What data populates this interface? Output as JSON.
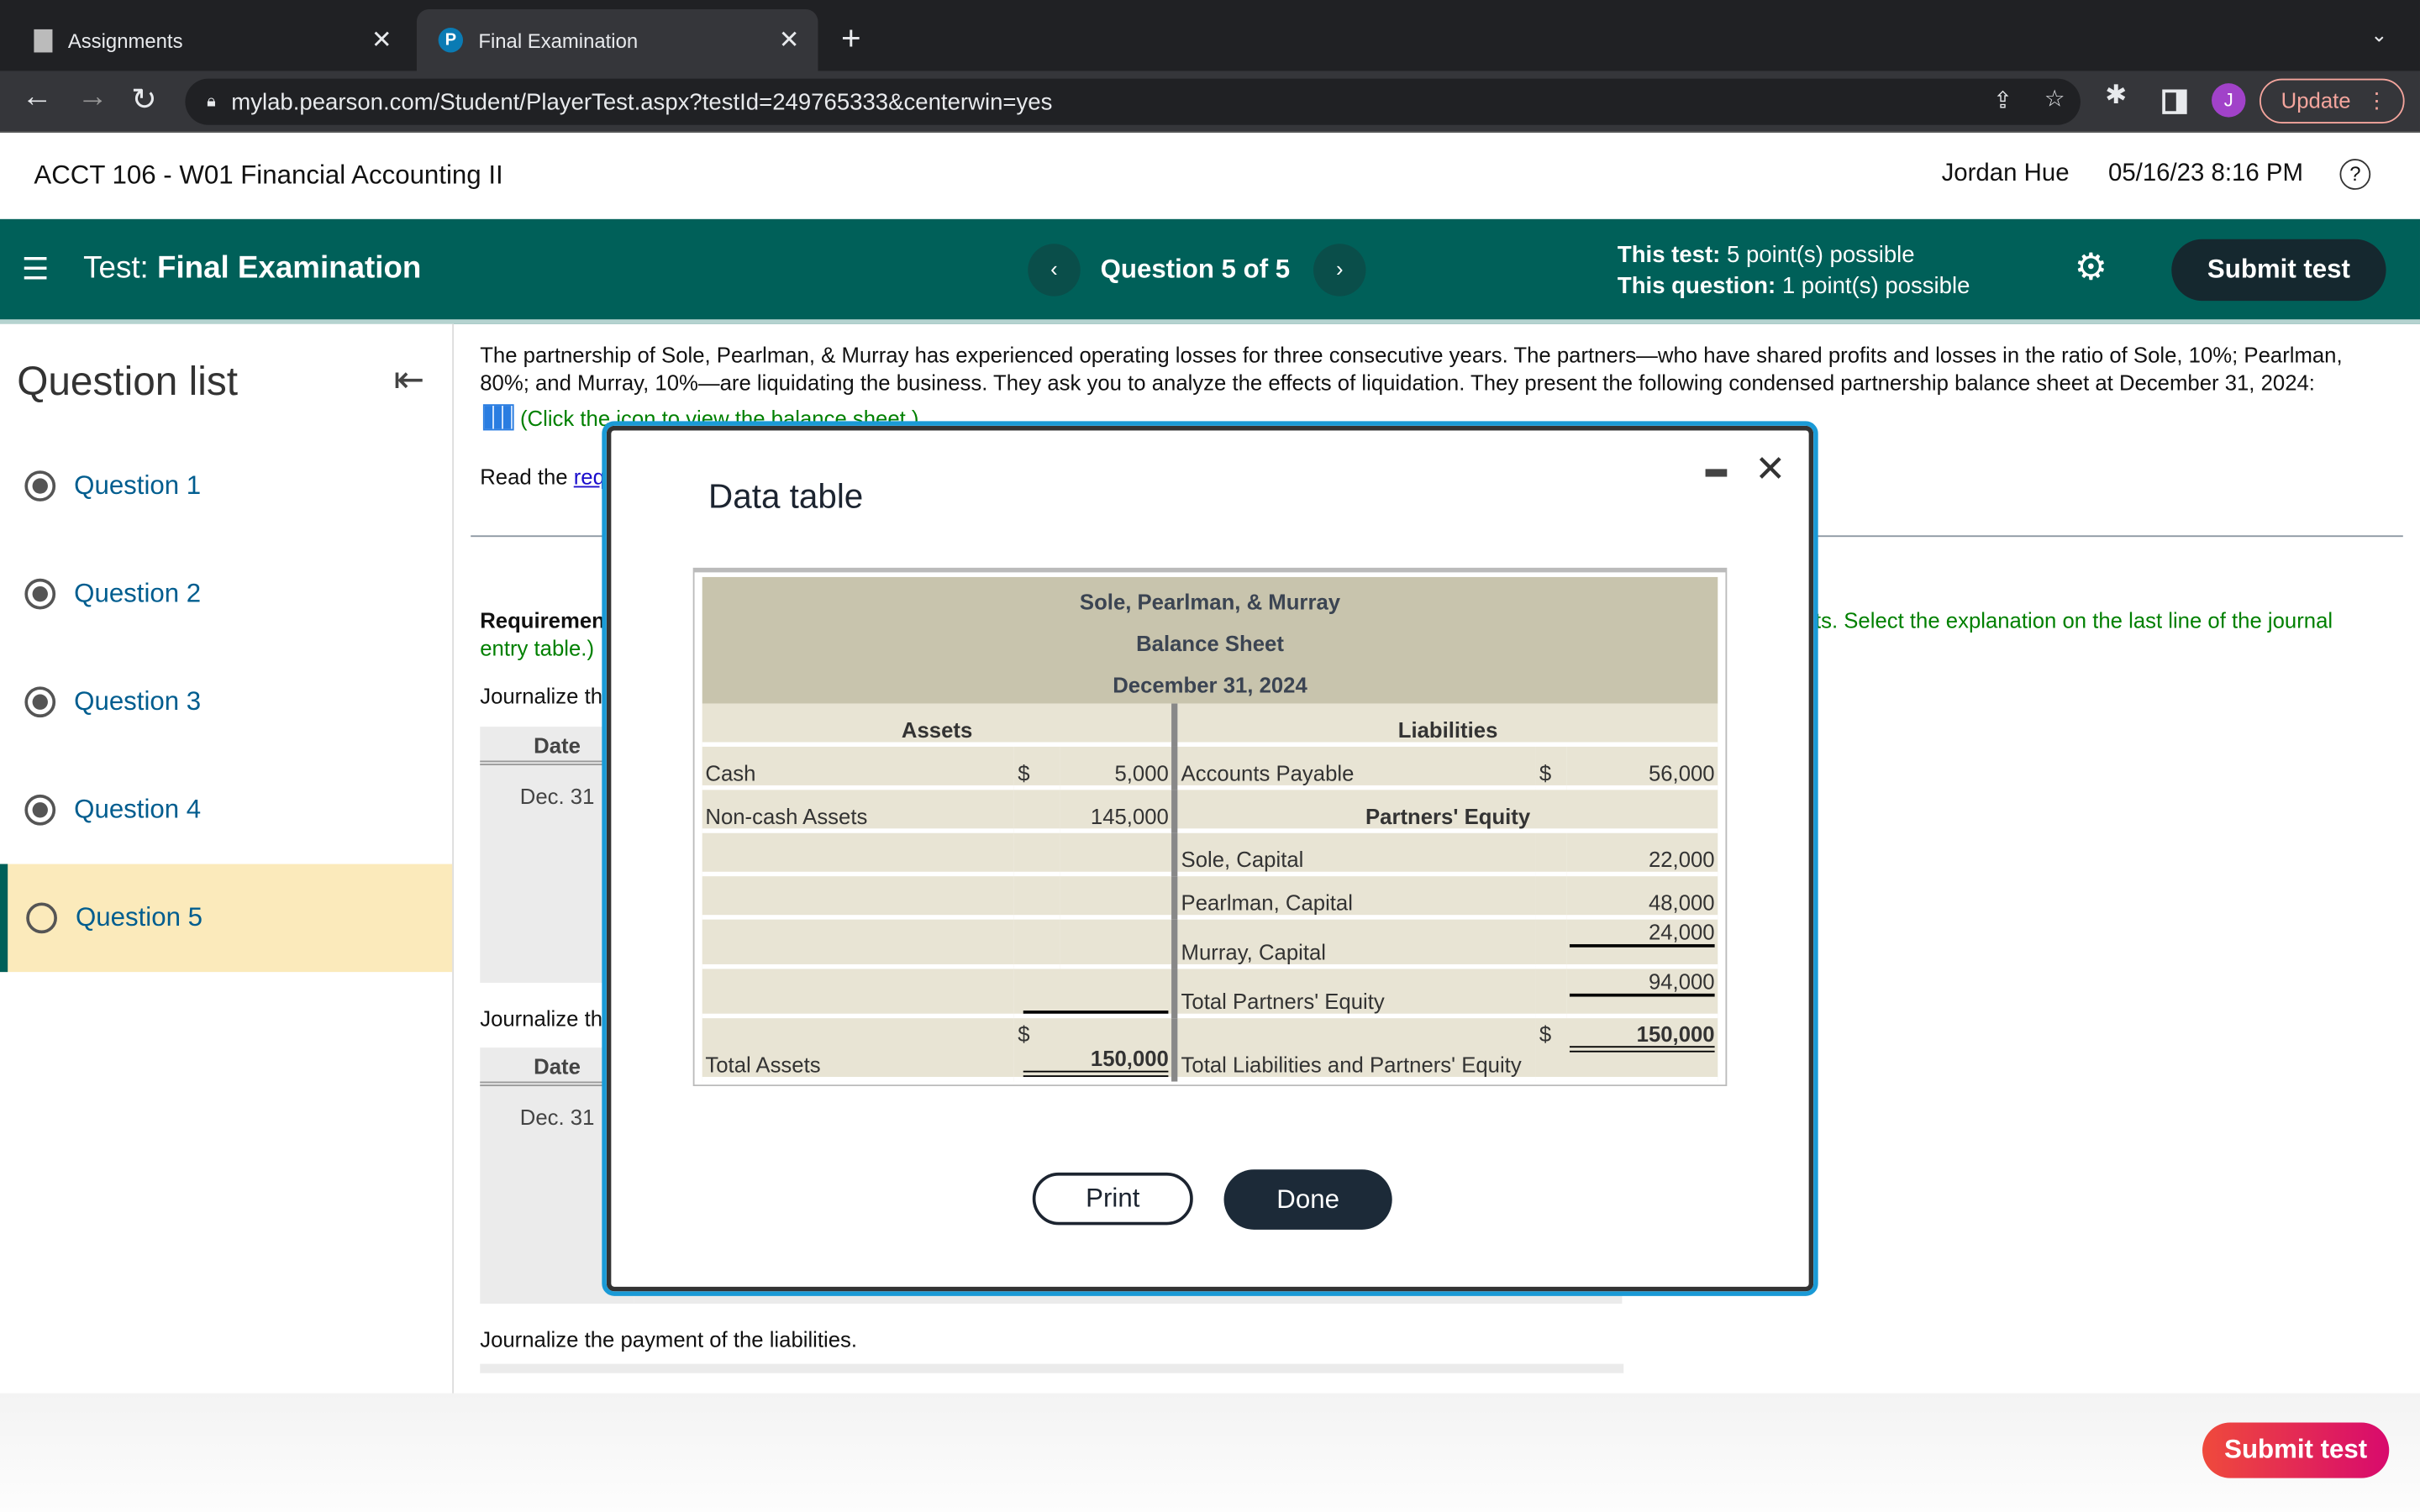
{
  "browser": {
    "tabs": [
      {
        "title": "Assignments",
        "icon": "doc-icon"
      },
      {
        "title": "Final Examination",
        "icon": "pearson-p-icon"
      }
    ],
    "new_tab": "+",
    "url": "mylab.pearson.com/Student/PlayerTest.aspx?testId=249765333&centerwin=yes",
    "profile_initial": "J",
    "update_label": "Update"
  },
  "course": {
    "title": "ACCT 106 - W01 Financial Accounting II",
    "user": "Jordan Hue",
    "datetime": "05/16/23 8:16 PM"
  },
  "testbar": {
    "prefix": "Test:",
    "name": "Final Examination",
    "question_nav": "Question 5 of 5",
    "test_points_label": "This test:",
    "test_points": "5 point(s) possible",
    "question_points_label": "This question:",
    "question_points": "1 point(s) possible",
    "submit": "Submit test"
  },
  "sidebar": {
    "title": "Question list",
    "items": [
      {
        "label": "Question 1",
        "answered": true
      },
      {
        "label": "Question 2",
        "answered": true
      },
      {
        "label": "Question 3",
        "answered": true
      },
      {
        "label": "Question 4",
        "answered": true
      },
      {
        "label": "Question 5",
        "answered": false,
        "current": true
      }
    ]
  },
  "main": {
    "intro": "The partnership of Sole, Pearlman, & Murray has experienced operating losses for three consecutive years. The partners—who have shared profits and losses in the ratio of Sole, 10%; Pearlman, 80%; and Murray, 10%—are liquidating the business. They ask you to analyze the effects of liquidation. They present the following condensed partnership balance sheet at December 31, 2024:",
    "click_icon": "(Click the icon to view the balance sheet.)",
    "read_prefix": "Read the ",
    "read_link": "req",
    "req_label": "Requiremen",
    "req_green_right": "ts. Select the explanation on the last line of the journal",
    "req_green_left": "entry table.)",
    "journalize1": "Journalize th",
    "journalize2": "Journalize th",
    "journalize3": "Journalize the payment of the liabilities.",
    "date_header": "Date",
    "date_value": "Dec. 31"
  },
  "footer": {
    "submit": "Submit test"
  },
  "modal": {
    "title": "Data table",
    "company": "Sole, Pearlman, & Murray",
    "statement": "Balance Sheet",
    "date": "December 31, 2024",
    "assets_header": "Assets",
    "liabilities_header": "Liabilities",
    "equity_header": "Partners' Equity",
    "currency": "$",
    "assets": [
      {
        "label": "Cash",
        "value": "5,000"
      },
      {
        "label": "Non-cash Assets",
        "value": "145,000"
      }
    ],
    "total_assets": {
      "label": "Total Assets",
      "value": "150,000"
    },
    "liabilities": [
      {
        "label": "Accounts Payable",
        "value": "56,000"
      }
    ],
    "equity": [
      {
        "label": "Sole, Capital",
        "value": "22,000"
      },
      {
        "label": "Pearlman, Capital",
        "value": "48,000"
      },
      {
        "label": "Murray, Capital",
        "value": "24,000"
      }
    ],
    "total_equity": {
      "label": "Total Partners' Equity",
      "value": "94,000"
    },
    "total_liab_equity": {
      "label": "Total Liabilities and Partners' Equity",
      "value": "150,000"
    },
    "print": "Print",
    "done": "Done"
  }
}
